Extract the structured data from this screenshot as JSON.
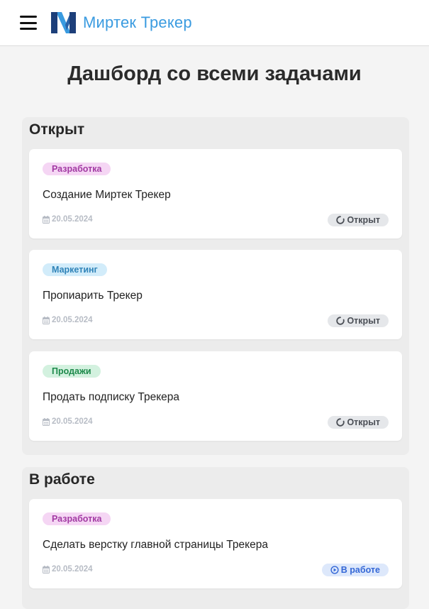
{
  "header": {
    "brand": "Миртек Трекер",
    "logo_letter": "M"
  },
  "page_title": "Дашборд со всеми задачами",
  "columns": [
    {
      "title": "Открыт",
      "cards": [
        {
          "tag": "Разработка",
          "title": "Создание Миртек Трекер",
          "date": "20.05.2024",
          "status": "Открыт"
        },
        {
          "tag": "Маркетинг",
          "title": "Пропиарить Трекер",
          "date": "20.05.2024",
          "status": "Открыт"
        },
        {
          "tag": "Продажи",
          "title": "Продать подписку Трекера",
          "date": "20.05.2024",
          "status": "Открыт"
        }
      ]
    },
    {
      "title": "В работе",
      "cards": [
        {
          "tag": "Разработка",
          "title": "Сделать верстку главной страницы Трекера",
          "date": "20.05.2024",
          "status": "В работе"
        }
      ]
    }
  ],
  "icons": {
    "menu": "hamburger-icon",
    "calendar": "calendar-icon",
    "status_open": "circle-notch-icon",
    "status_progress": "play-circle-icon"
  },
  "colors": {
    "brand": "#3a9be0",
    "tag_dev": "#a23aa3",
    "tag_marketing": "#2f83b8",
    "tag_sales": "#1e8a4b",
    "status_open": "#4b4f56",
    "status_progress": "#3467d6"
  }
}
